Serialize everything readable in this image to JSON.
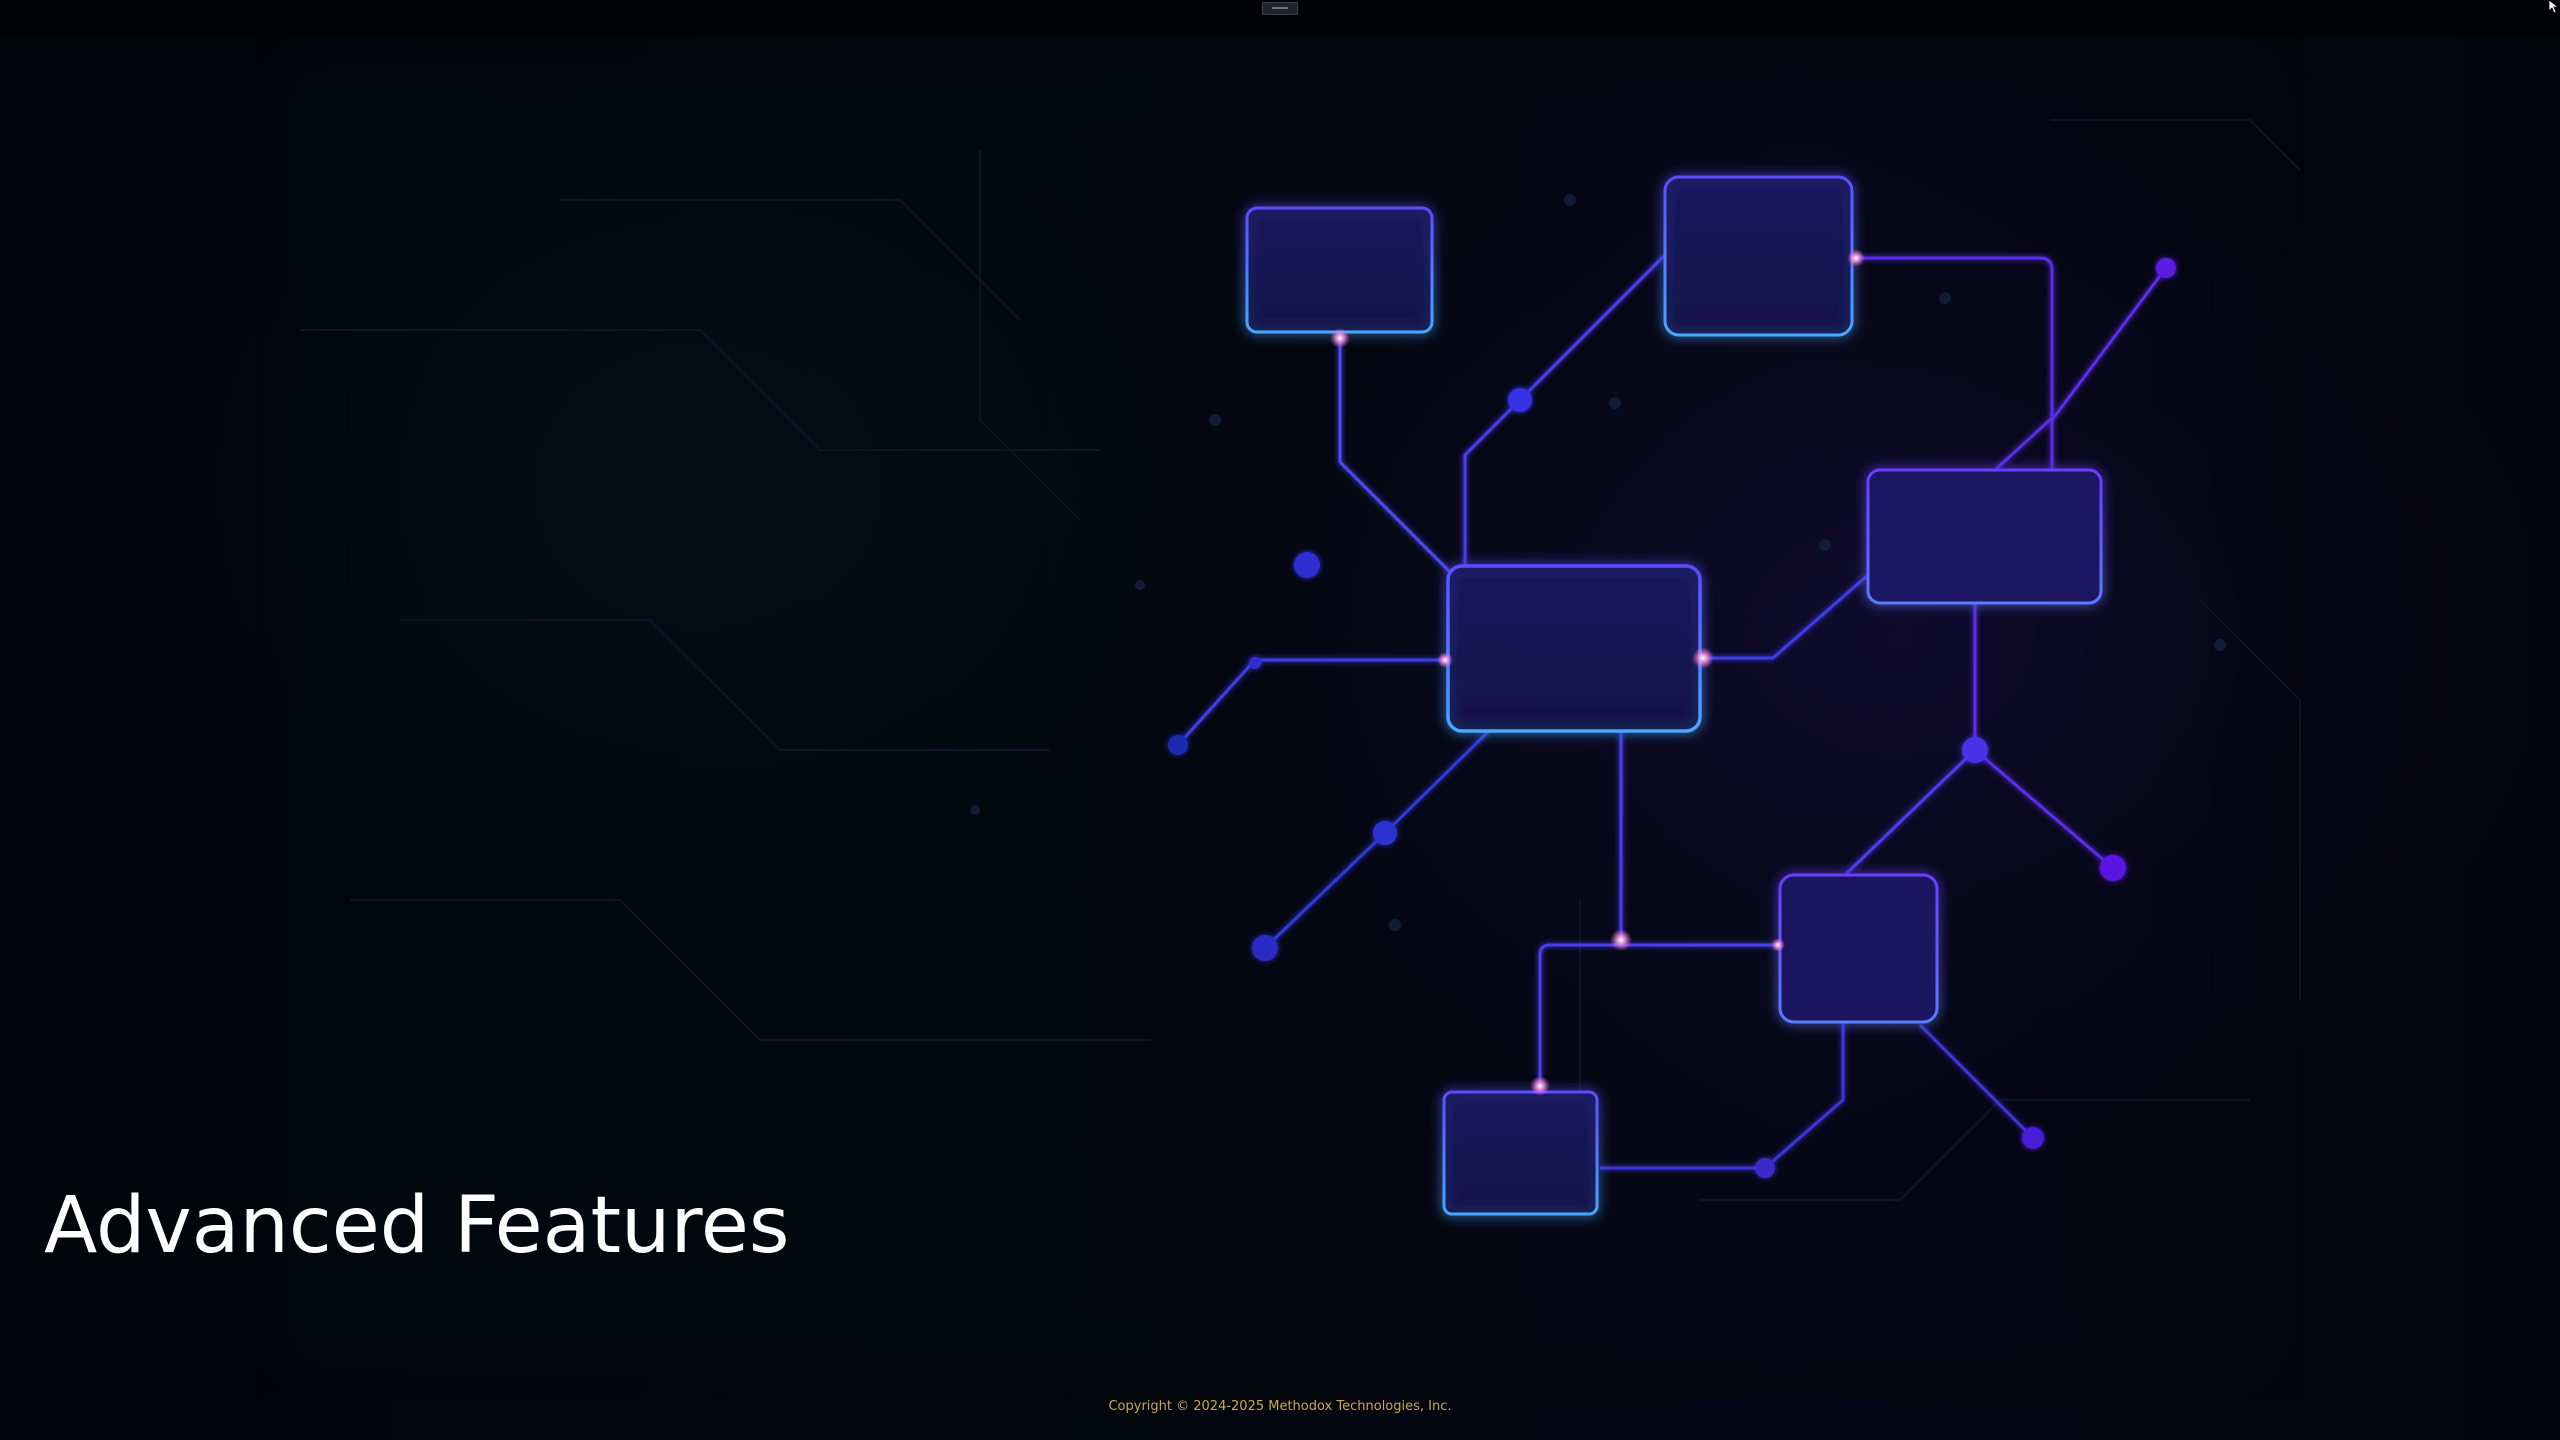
{
  "slide": {
    "title": "Advanced Features",
    "copyright": "Copyright © 2024-2025 Methodox Technologies, Inc."
  },
  "colors": {
    "background": "#020407",
    "node_fill": "#1b1a5e",
    "node_border": "#5a4cff",
    "line": "#4a3cf0",
    "dot": "#3b2fe6",
    "title_text": "#ffffff",
    "copyright_text": "#c9a94a"
  },
  "icons": {
    "cursor": "arrow-cursor-icon",
    "handle": "drag-handle-icon"
  }
}
